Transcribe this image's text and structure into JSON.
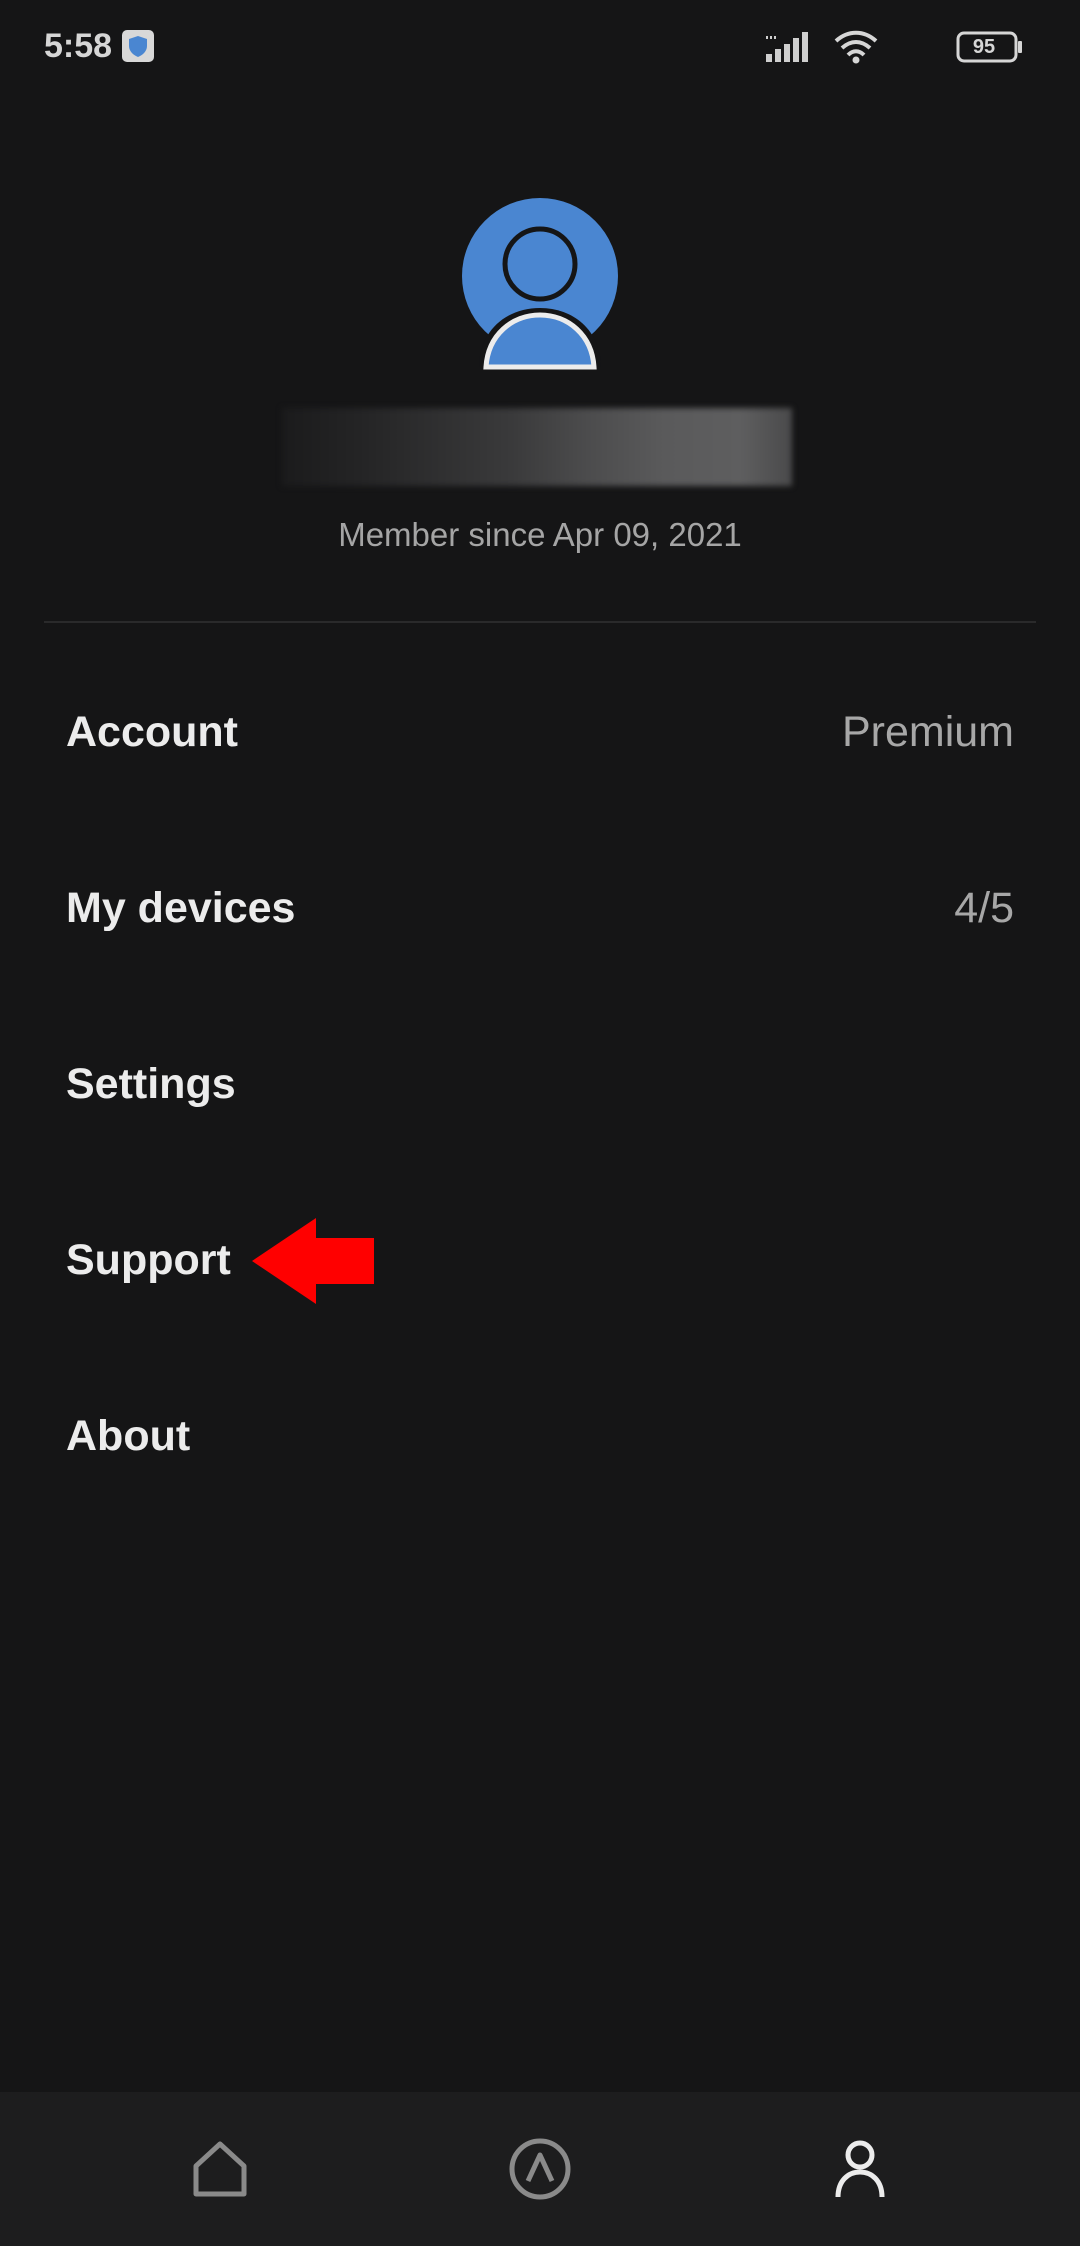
{
  "status_bar": {
    "time": "5:58",
    "battery_level": "95",
    "icons": [
      "vpn-shield-icon",
      "signal-icon",
      "wifi-icon",
      "battery-icon"
    ]
  },
  "profile": {
    "avatar_icon": "user-avatar-icon",
    "avatar_color": "#4a86d1",
    "member_since": "Member since Apr 09, 2021"
  },
  "menu": {
    "items": [
      {
        "label": "Account",
        "value": "Premium"
      },
      {
        "label": "My devices",
        "value": "4/5"
      },
      {
        "label": "Settings",
        "value": ""
      },
      {
        "label": "Support",
        "value": ""
      },
      {
        "label": "About",
        "value": ""
      }
    ]
  },
  "annotation": {
    "arrow_color": "#ff0000",
    "points_to": "Support"
  },
  "bottom_nav": {
    "items": [
      {
        "icon": "home-icon",
        "active": false
      },
      {
        "icon": "vpn-connect-icon",
        "active": false
      },
      {
        "icon": "profile-icon",
        "active": true
      }
    ]
  },
  "colors": {
    "background": "#151516",
    "nav_background": "#1d1d1e",
    "text_primary": "#ececec",
    "text_secondary": "#a7a7a7"
  }
}
